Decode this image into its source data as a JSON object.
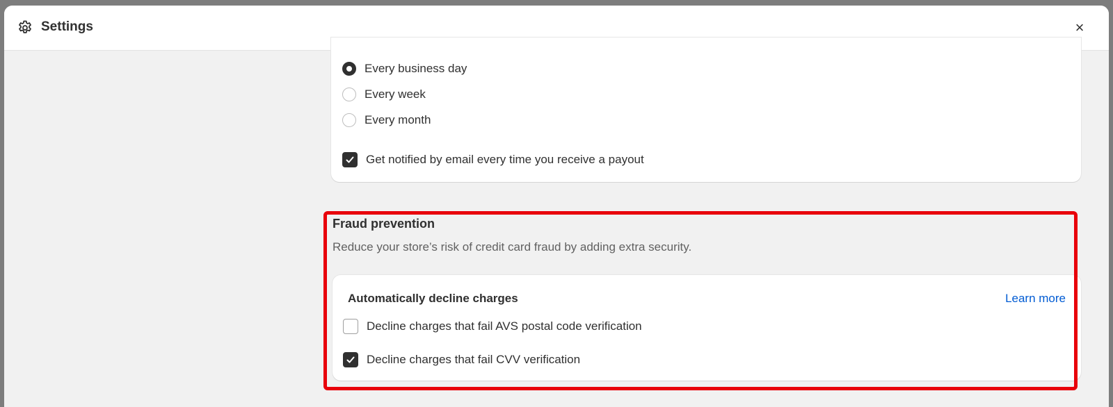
{
  "window": {
    "title": "Settings",
    "close_label": "×"
  },
  "payout_schedule": {
    "options": [
      {
        "label": "Every business day",
        "selected": true
      },
      {
        "label": "Every week",
        "selected": false
      },
      {
        "label": "Every month",
        "selected": false
      }
    ],
    "notify_email": {
      "label": "Get notified by email every time you receive a payout",
      "checked": true
    }
  },
  "fraud_prevention": {
    "heading": "Fraud prevention",
    "description": "Reduce your store’s risk of credit card fraud by adding extra security.",
    "card_title": "Automatically decline charges",
    "learn_more": "Learn more",
    "options": [
      {
        "label": "Decline charges that fail AVS postal code verification",
        "checked": false
      },
      {
        "label": "Decline charges that fail CVV verification",
        "checked": true
      }
    ]
  },
  "colors": {
    "highlight": "#e8000b",
    "link": "#005bd3",
    "text": "#303030"
  }
}
